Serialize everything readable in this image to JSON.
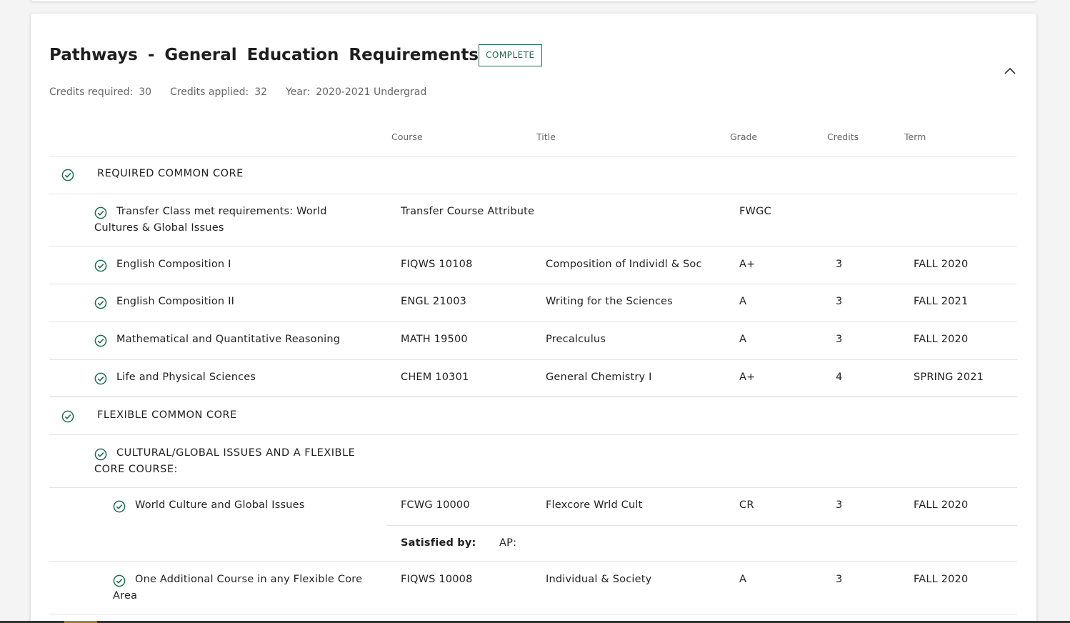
{
  "section": {
    "title": "Pathways - General Education Requirements",
    "badge": "COMPLETE",
    "credits_required_label": "Credits required:",
    "credits_required": "30",
    "credits_applied_label": "Credits applied:",
    "credits_applied": "32",
    "year_label": "Year:",
    "year": "2020-2021 Undergrad"
  },
  "columns": {
    "course": "Course",
    "title": "Title",
    "grade": "Grade",
    "credits": "Credits",
    "term": "Term"
  },
  "groups": {
    "required": "REQUIRED COMMON CORE",
    "flexible": "FLEXIBLE COMMON CORE"
  },
  "rows": {
    "transfer": {
      "line1": "Transfer Class met requirements: World",
      "line2": "Cultures & Global Issues",
      "course": "Transfer Course Attribute",
      "grade": "FWGC"
    },
    "eng1": {
      "name": "English Composition I",
      "course": "FIQWS 10108",
      "title": "Composition of Individl & Soc",
      "grade": "A+",
      "credits": "3",
      "term": "FALL 2020"
    },
    "eng2": {
      "name": "English Composition II",
      "course": "ENGL 21003",
      "title": "Writing for the Sciences",
      "grade": "A",
      "credits": "3",
      "term": "FALL 2021"
    },
    "math": {
      "name": "Mathematical and Quantitative Reasoning",
      "course": "MATH 19500",
      "title": "Precalculus",
      "grade": "A",
      "credits": "3",
      "term": "FALL 2020"
    },
    "life": {
      "name": "Life and Physical Sciences",
      "course": "CHEM 10301",
      "title": "General Chemistry I",
      "grade": "A+",
      "credits": "4",
      "term": "SPRING 2021"
    },
    "cultural": {
      "line1": "CULTURAL/GLOBAL ISSUES AND A FLEXIBLE",
      "line2": "CORE COURSE:"
    },
    "world": {
      "name": "World Culture and Global Issues",
      "course": "FCWG 10000",
      "title": "Flexcore Wrld Cult",
      "grade": "CR",
      "credits": "3",
      "term": "FALL 2020"
    },
    "satisfied": {
      "label": "Satisfied by:",
      "value": "AP:"
    },
    "additional": {
      "line1": "One Additional Course in any Flexible Core",
      "line2": "Area",
      "course": "FIQWS 10008",
      "title": "Individual & Society",
      "grade": "A",
      "credits": "3",
      "term": "FALL 2020"
    }
  },
  "colors": {
    "accent": "#1e6b52"
  }
}
